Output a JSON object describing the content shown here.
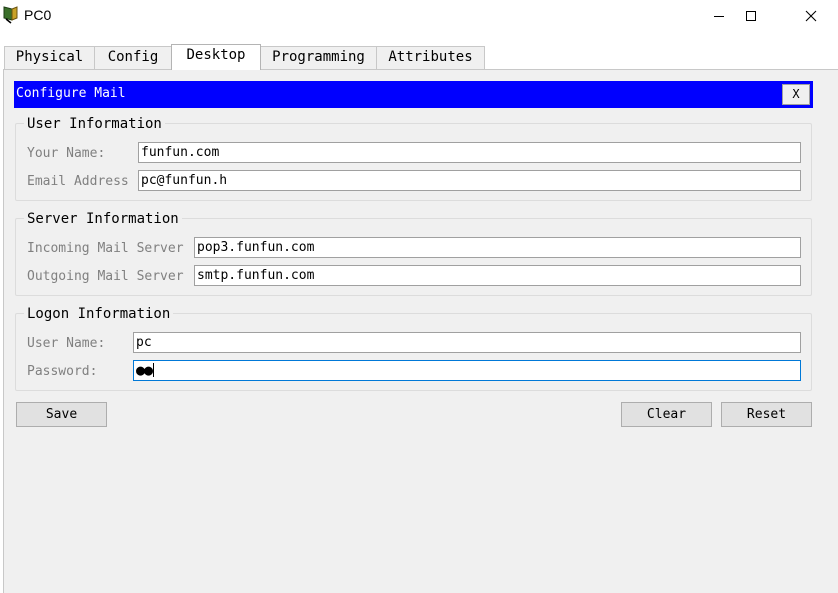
{
  "window": {
    "title": "PC0",
    "minimize_icon": "minimize-icon",
    "maximize_icon": "maximize-icon",
    "close_icon": "close-icon"
  },
  "tabs": [
    {
      "label": "Physical"
    },
    {
      "label": "Config"
    },
    {
      "label": "Desktop",
      "active": true
    },
    {
      "label": "Programming"
    },
    {
      "label": "Attributes"
    }
  ],
  "app": {
    "title": "Configure Mail",
    "close_label": "X",
    "header_color": "#0000ff"
  },
  "user_info": {
    "legend": "User Information",
    "name_label": "Your Name:",
    "name_value": "funfun.com",
    "email_label": "Email Address",
    "email_value": "pc@funfun.h"
  },
  "server_info": {
    "legend": "Server Information",
    "incoming_label": "Incoming Mail Server",
    "incoming_value": "pop3.funfun.com",
    "outgoing_label": "Outgoing Mail Server",
    "outgoing_value": "smtp.funfun.com"
  },
  "logon_info": {
    "legend": "Logon Information",
    "username_label": "User Name:",
    "username_value": "pc",
    "password_label": "Password:",
    "password_mask": "●●"
  },
  "buttons": {
    "save": "Save",
    "clear": "Clear",
    "reset": "Reset"
  }
}
